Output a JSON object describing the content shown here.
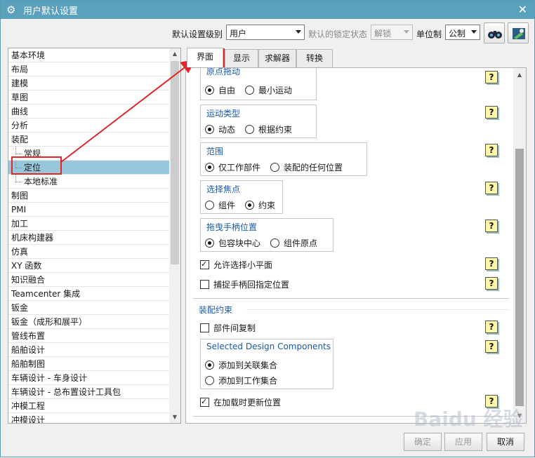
{
  "title": "用户默认设置",
  "toolbar": {
    "level_label": "默认设置级别",
    "level_value": "用户",
    "lock_label": "默认的锁定状态",
    "lock_value": "解锁",
    "unit_label": "单位制",
    "unit_value": "公制"
  },
  "left_list": [
    {
      "label": "基本环境",
      "sub": false
    },
    {
      "label": "布局",
      "sub": false
    },
    {
      "label": "建模",
      "sub": false
    },
    {
      "label": "草图",
      "sub": false
    },
    {
      "label": "曲线",
      "sub": false
    },
    {
      "label": "分析",
      "sub": false
    },
    {
      "label": "装配",
      "sub": false
    },
    {
      "label": "常规",
      "sub": true
    },
    {
      "label": "定位",
      "sub": true,
      "selected": true
    },
    {
      "label": "本地标准",
      "sub": true
    },
    {
      "label": "制图",
      "sub": false
    },
    {
      "label": "PMI",
      "sub": false
    },
    {
      "label": "加工",
      "sub": false
    },
    {
      "label": "机床构建器",
      "sub": false
    },
    {
      "label": "仿真",
      "sub": false
    },
    {
      "label": "XY 函数",
      "sub": false
    },
    {
      "label": "知识融合",
      "sub": false
    },
    {
      "label": "Teamcenter 集成",
      "sub": false
    },
    {
      "label": "钣金",
      "sub": false
    },
    {
      "label": "钣金（成形和展平）",
      "sub": false
    },
    {
      "label": "管线布置",
      "sub": false
    },
    {
      "label": "船舶设计",
      "sub": false
    },
    {
      "label": "船舶制图",
      "sub": false
    },
    {
      "label": "车辆设计 - 车身设计",
      "sub": false
    },
    {
      "label": "车辆设计 - 总布置设计工具包",
      "sub": false
    },
    {
      "label": "冲模工程",
      "sub": false
    },
    {
      "label": "冲模设计",
      "sub": false
    }
  ],
  "tabs": [
    "界面",
    "显示",
    "求解器",
    "转换"
  ],
  "panel": {
    "g1_title": "原点拖动",
    "g1_opt1": "自由",
    "g1_opt2": "最小运动",
    "g2_title": "运动类型",
    "g2_opt1": "动态",
    "g2_opt2": "根据约束",
    "g3_title": "范围",
    "g3_opt1": "仅工作部件",
    "g3_opt2": "装配的任何位置",
    "g4_title": "选择焦点",
    "g4_opt1": "组件",
    "g4_opt2": "约束",
    "g5_title": "拖曳手柄位置",
    "g5_opt1": "包容块中心",
    "g5_opt2": "组件原点",
    "chk1": "允许选择小平面",
    "chk2": "捕捉手柄回指定位置",
    "section2": "装配约束",
    "chk3": "部件间复制",
    "g6_title": "Selected Design Components",
    "g6_opt1": "添加到关联集合",
    "g6_opt2": "添加到工作集合",
    "chk4": "在加载时更新位置",
    "help": "?"
  },
  "buttons": {
    "ok": "确定",
    "apply": "应用",
    "cancel": "取消"
  },
  "watermark": "Baidu 经验"
}
